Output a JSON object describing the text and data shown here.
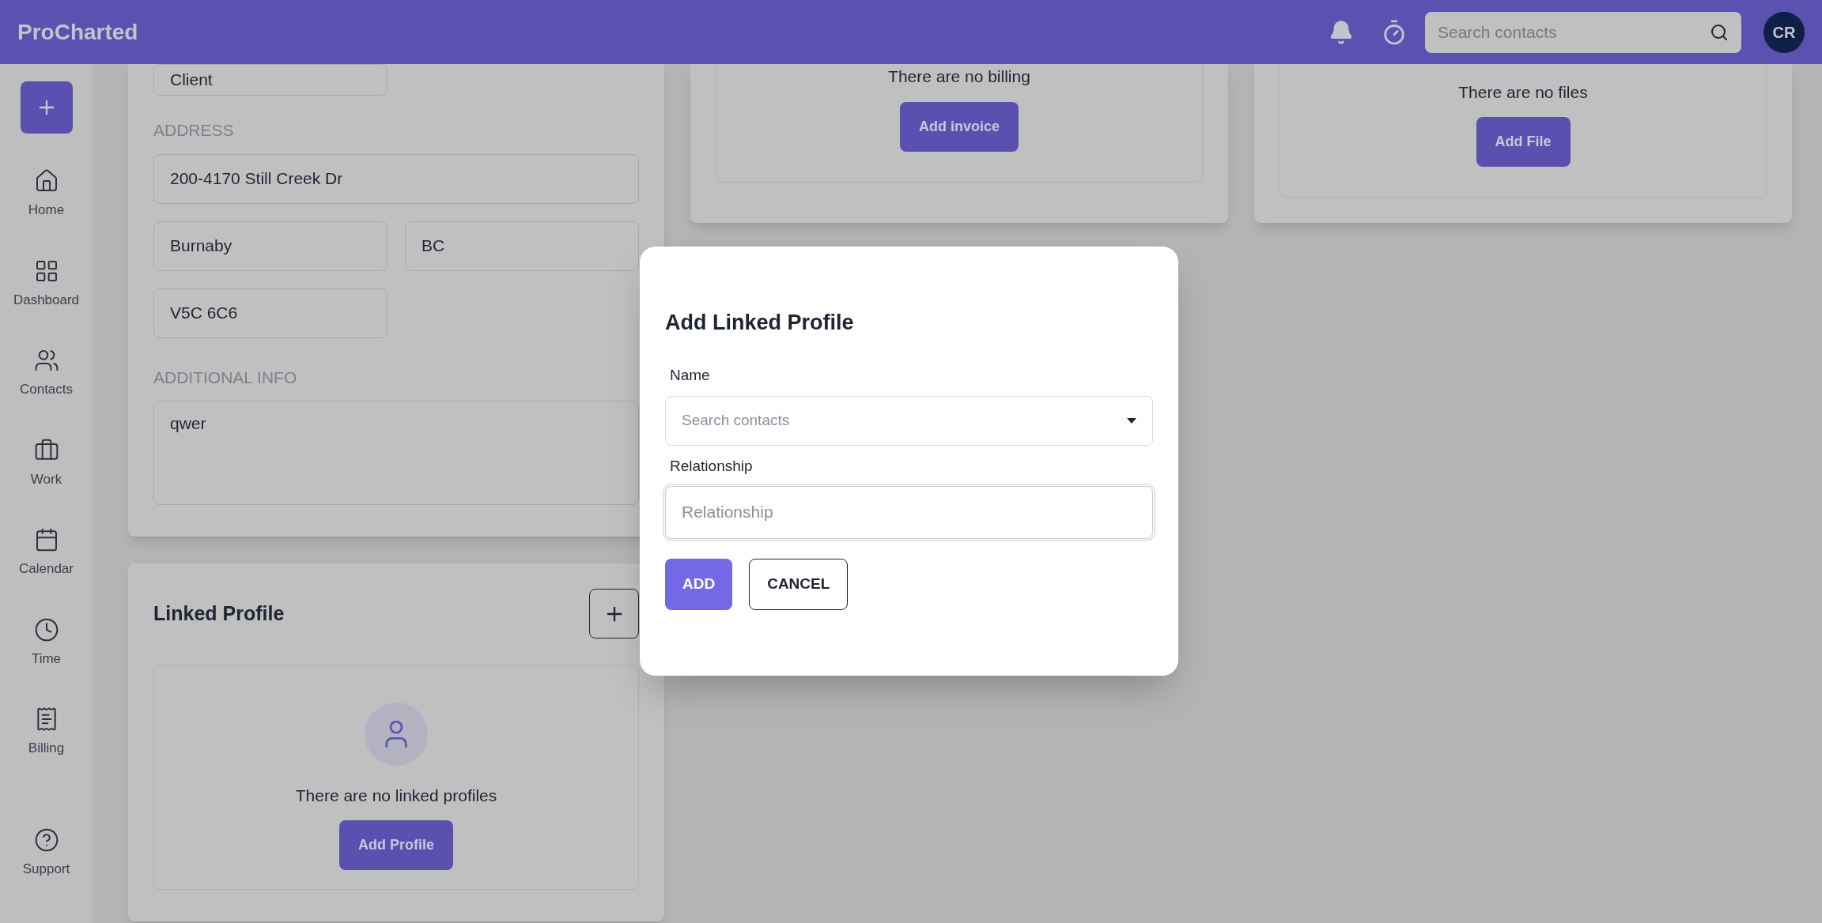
{
  "header": {
    "logo": "ProCharted",
    "search": {
      "placeholder": "Search contacts"
    },
    "avatar": "CR"
  },
  "sidebar": {
    "items": [
      {
        "kind": "home",
        "label": "Home"
      },
      {
        "kind": "dashboard",
        "label": "Dashboard"
      },
      {
        "kind": "contacts",
        "label": "Contacts"
      },
      {
        "kind": "work",
        "label": "Work"
      },
      {
        "kind": "calendar",
        "label": "Calendar"
      },
      {
        "kind": "time",
        "label": "Time"
      },
      {
        "kind": "billing",
        "label": "Billing"
      }
    ],
    "support": {
      "kind": "support",
      "label": "Support"
    }
  },
  "details_card": {
    "type_select": "Client",
    "address_label": "ADDRESS",
    "street": "200-4170 Still Creek Dr",
    "city": "Burnaby",
    "province": "BC",
    "postal": "V5C 6C6",
    "additional_label": "ADDITIONAL INFO",
    "additional_info": "qwer"
  },
  "linked_card": {
    "title": "Linked Profile",
    "empty_text": "There are no linked profiles",
    "button": "Add Profile"
  },
  "billing_card": {
    "empty_text": "There are no billing",
    "button": "Add invoice"
  },
  "files_card": {
    "empty_text": "There are no files",
    "button": "Add File"
  },
  "modal": {
    "title": "Add Linked Profile",
    "name_label": "Name",
    "name_placeholder": "Search contacts",
    "relationship_label": "Relationship",
    "relationship_placeholder": "Relationship",
    "add_button": "ADD",
    "cancel_button": "CANCEL"
  }
}
